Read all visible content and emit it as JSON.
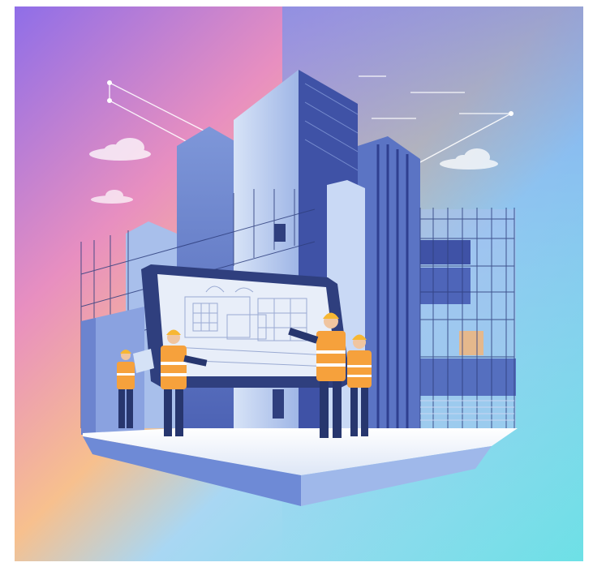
{
  "image": {
    "subject": "illustration",
    "palette": {
      "sky_top_left": "#8f6ee8",
      "sky_mid_left": "#f29bb4",
      "sky_bottom_left": "#f7c98e",
      "sky_right": "#5fb6ef",
      "sky_bottom_right": "#6de0e6",
      "building_dark": "#3f52a6",
      "building_mid": "#6b86cf",
      "building_light": "#c6d7f4",
      "vest_orange": "#f6a13c",
      "helmet_yellow": "#f7b733",
      "worker_navy": "#27366e",
      "platform_top": "#f4f7fc",
      "platform_side": "#5b79c9"
    },
    "icons": [
      "cloud-icon",
      "network-node-icon"
    ]
  }
}
